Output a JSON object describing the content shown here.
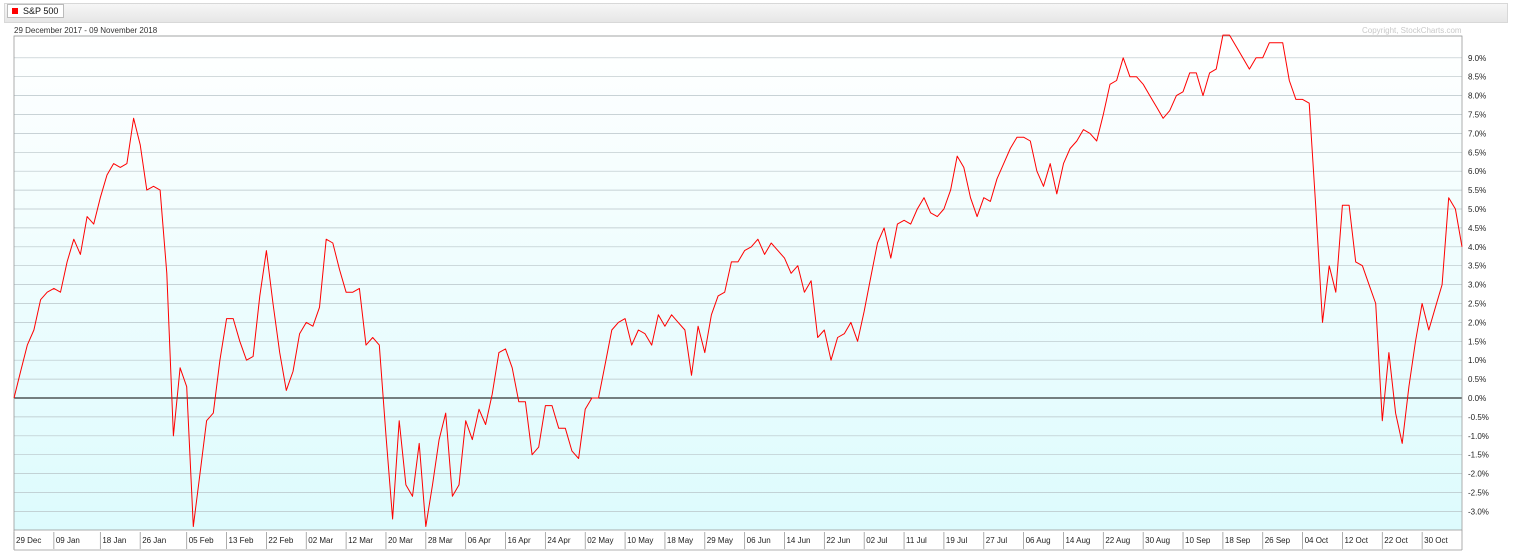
{
  "header": {
    "legend_label": "S&P 500",
    "legend_color": "#ff0000",
    "date_range": "29 December 2017 - 09 November 2018",
    "copyright": "Copyright, StockCharts.com"
  },
  "chart_data": {
    "type": "line",
    "title": "",
    "xlabel": "",
    "ylabel": "",
    "ylim": [
      -3.5,
      9.5
    ],
    "y_ticks": [
      "9.0%",
      "8.5%",
      "8.0%",
      "7.5%",
      "7.0%",
      "6.5%",
      "6.0%",
      "5.5%",
      "5.0%",
      "4.5%",
      "4.0%",
      "3.5%",
      "3.0%",
      "2.5%",
      "2.0%",
      "1.5%",
      "1.0%",
      "0.5%",
      "0.0%",
      "-0.5%",
      "-1.0%",
      "-1.5%",
      "-2.0%",
      "-2.5%",
      "-3.0%"
    ],
    "y_tick_values": [
      9.0,
      8.5,
      8.0,
      7.5,
      7.0,
      6.5,
      6.0,
      5.5,
      5.0,
      4.5,
      4.0,
      3.5,
      3.0,
      2.5,
      2.0,
      1.5,
      1.0,
      0.5,
      0.0,
      -0.5,
      -1.0,
      -1.5,
      -2.0,
      -2.5,
      -3.0
    ],
    "x_ticks": [
      "29 Dec",
      "09 Jan",
      "18 Jan",
      "26 Jan",
      "05 Feb",
      "13 Feb",
      "22 Feb",
      "02 Mar",
      "12 Mar",
      "20 Mar",
      "28 Mar",
      "06 Apr",
      "16 Apr",
      "24 Apr",
      "02 May",
      "10 May",
      "18 May",
      "29 May",
      "06 Jun",
      "14 Jun",
      "22 Jun",
      "02 Jul",
      "11 Jul",
      "19 Jul",
      "27 Jul",
      "06 Aug",
      "14 Aug",
      "22 Aug",
      "30 Aug",
      "10 Sep",
      "18 Sep",
      "26 Sep",
      "04 Oct",
      "12 Oct",
      "22 Oct",
      "30 Oct"
    ],
    "x_tick_index": [
      0,
      6,
      13,
      19,
      26,
      32,
      38,
      44,
      50,
      56,
      62,
      68,
      74,
      80,
      86,
      92,
      98,
      104,
      110,
      116,
      122,
      128,
      134,
      140,
      146,
      152,
      158,
      164,
      170,
      176,
      182,
      188,
      194,
      200,
      206,
      212
    ],
    "grid": true,
    "legend_position": "top-left",
    "baseline": 0.0,
    "series": [
      {
        "name": "S&P 500",
        "color": "#ff0000",
        "values": [
          0.0,
          0.7,
          1.4,
          1.8,
          2.6,
          2.8,
          2.9,
          2.8,
          3.6,
          4.2,
          3.8,
          4.8,
          4.6,
          5.3,
          5.9,
          6.2,
          6.1,
          6.2,
          7.4,
          6.7,
          5.5,
          5.6,
          5.5,
          3.3,
          -1.0,
          0.8,
          0.3,
          -3.4,
          -2.0,
          -0.6,
          -0.4,
          1.0,
          2.1,
          2.1,
          1.5,
          1.0,
          1.1,
          2.7,
          3.9,
          2.5,
          1.2,
          0.2,
          0.7,
          1.7,
          2.0,
          1.9,
          2.4,
          4.2,
          4.1,
          3.4,
          2.8,
          2.8,
          2.9,
          1.4,
          1.6,
          1.4,
          -1.0,
          -3.2,
          -0.6,
          -2.3,
          -2.6,
          -1.2,
          -3.4,
          -2.3,
          -1.1,
          -0.4,
          -2.6,
          -2.3,
          -0.6,
          -1.1,
          -0.3,
          -0.7,
          0.1,
          1.2,
          1.3,
          0.8,
          -0.1,
          -0.1,
          -1.5,
          -1.3,
          -0.2,
          -0.2,
          -0.8,
          -0.8,
          -1.4,
          -1.6,
          -0.3,
          0.0,
          0.0,
          0.9,
          1.8,
          2.0,
          2.1,
          1.4,
          1.8,
          1.7,
          1.4,
          2.2,
          1.9,
          2.2,
          2.0,
          1.8,
          0.6,
          1.9,
          1.2,
          2.2,
          2.7,
          2.8,
          3.6,
          3.6,
          3.9,
          4.0,
          4.2,
          3.8,
          4.1,
          3.9,
          3.7,
          3.3,
          3.5,
          2.8,
          3.1,
          1.6,
          1.8,
          1.0,
          1.6,
          1.7,
          2.0,
          1.5,
          2.3,
          3.2,
          4.1,
          4.5,
          3.7,
          4.6,
          4.7,
          4.6,
          5.0,
          5.3,
          4.9,
          4.8,
          5.0,
          5.5,
          6.4,
          6.1,
          5.3,
          4.8,
          5.3,
          5.2,
          5.8,
          6.2,
          6.6,
          6.9,
          6.9,
          6.8,
          6.0,
          5.6,
          6.2,
          5.4,
          6.2,
          6.6,
          6.8,
          7.1,
          7.0,
          6.8,
          7.5,
          8.3,
          8.4,
          9.0,
          8.5,
          8.5,
          8.3,
          8.0,
          7.7,
          7.4,
          7.6,
          8.0,
          8.1,
          8.6,
          8.6,
          8.0,
          8.6,
          8.7,
          9.6,
          9.6,
          9.3,
          9.0,
          8.7,
          9.0,
          9.0,
          9.4,
          9.4,
          9.4,
          8.4,
          7.9,
          7.9,
          7.8,
          5.0,
          2.0,
          3.5,
          2.8,
          5.1,
          5.1,
          3.6,
          3.5,
          3.0,
          2.5,
          -0.6,
          1.2,
          -0.4,
          -1.2,
          0.3,
          1.5,
          2.5,
          1.8,
          2.4,
          3.0,
          5.3,
          5.0,
          4.0
        ]
      }
    ]
  }
}
